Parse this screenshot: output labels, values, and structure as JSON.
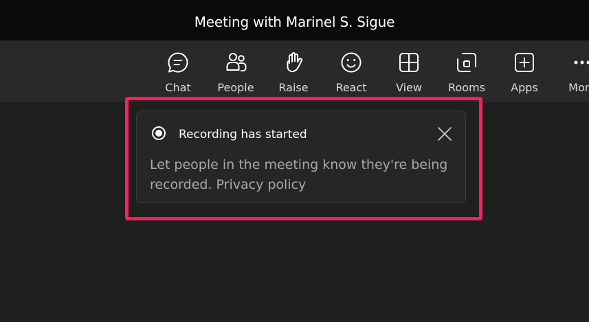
{
  "window": {
    "title": "Meeting with Marinel S. Sigue"
  },
  "toolbar": {
    "items": [
      {
        "label": "Chat",
        "icon": "chat-icon"
      },
      {
        "label": "People",
        "icon": "people-icon"
      },
      {
        "label": "Raise",
        "icon": "raise-hand-icon"
      },
      {
        "label": "React",
        "icon": "smile-icon"
      },
      {
        "label": "View",
        "icon": "grid-icon"
      },
      {
        "label": "Rooms",
        "icon": "rooms-icon"
      },
      {
        "label": "Apps",
        "icon": "plus-square-icon"
      },
      {
        "label": "More",
        "icon": "more-icon"
      }
    ]
  },
  "toast": {
    "icon": "recording-icon",
    "title": "Recording has started",
    "message": "Let people in the meeting know they're being recorded. Privacy policy",
    "close_icon": "close-icon"
  },
  "colors": {
    "titlebar_bg": "#0a0a0a",
    "toolbar_bg": "#292929",
    "stage_bg": "#1f1f1f",
    "toast_bg": "#262626",
    "highlight": "#ff1f5a"
  }
}
